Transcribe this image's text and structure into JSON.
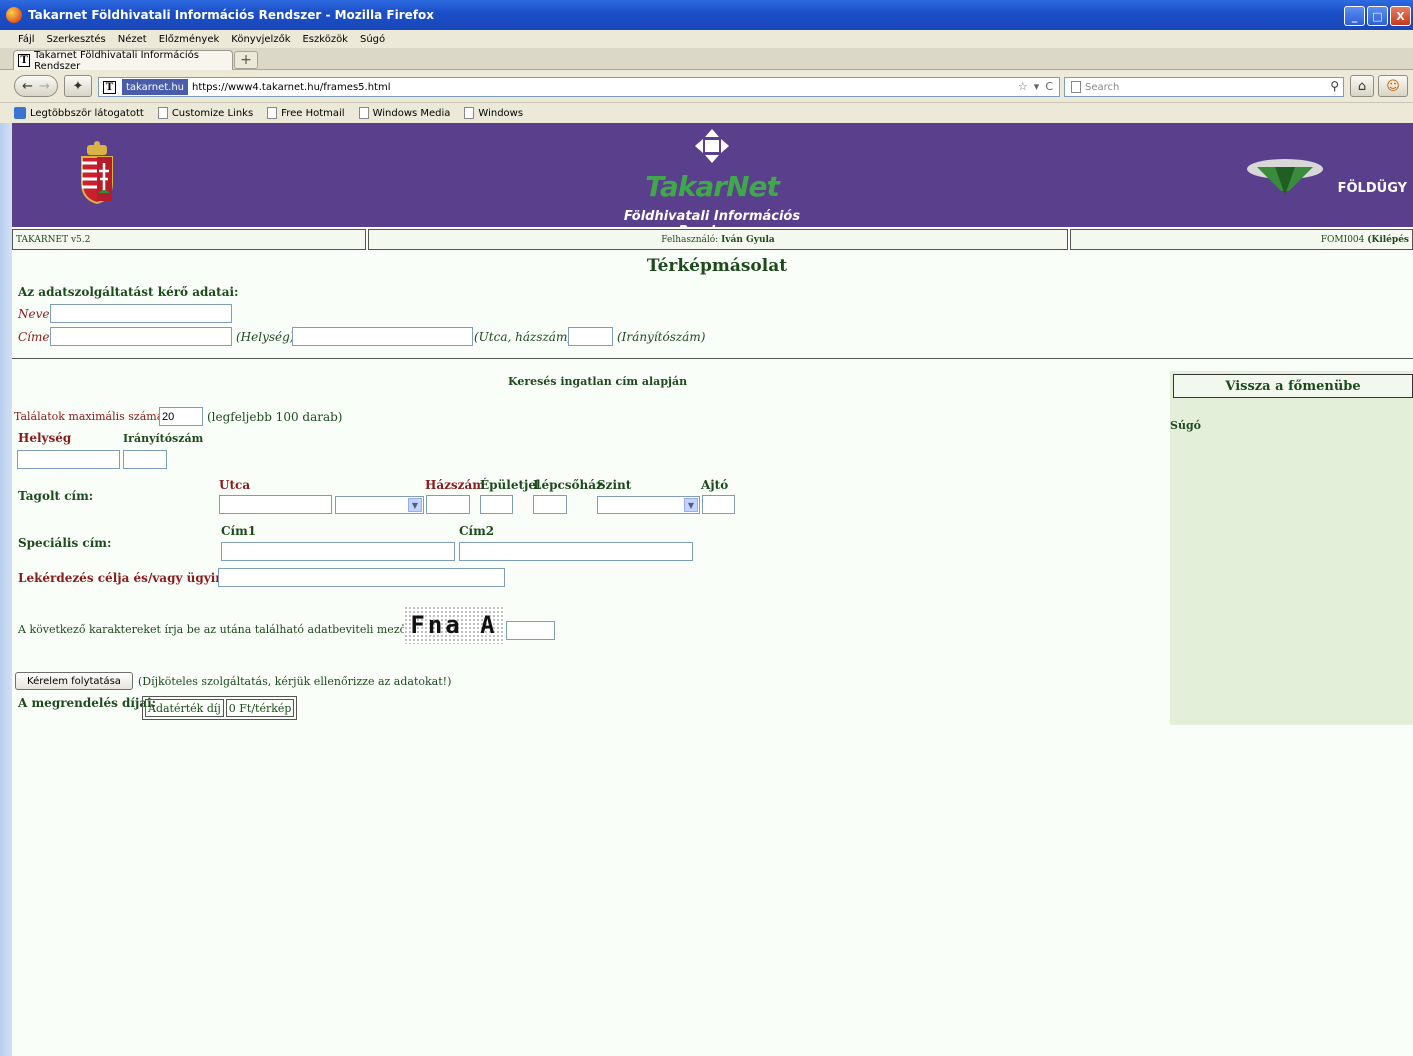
{
  "window": {
    "title": "Takarnet Földhivatali Információs Rendszer - Mozilla Firefox",
    "controls": [
      "_",
      "□",
      "X"
    ]
  },
  "menu": [
    "Fájl",
    "Szerkesztés",
    "Nézet",
    "Előzmények",
    "Könyvjelzők",
    "Eszközök",
    "Súgó"
  ],
  "tab": {
    "label": "Takarnet Földhivatali Információs Rendszer",
    "new_tab": "+"
  },
  "nav": {
    "identity": "takarnet.hu",
    "url": "https://www4.takarnet.hu/frames5.html",
    "search_placeholder": "Search"
  },
  "bookmarks": [
    "Legtöbbször látogatott",
    "Customize Links",
    "Free Hotmail",
    "Windows Media",
    "Windows"
  ],
  "header": {
    "logo_word": "TakarNet",
    "logo_subtitle": "Földhivatali Információs Rendszer",
    "right_logo": "FÖLDÜGY"
  },
  "status": {
    "version": "TAKARNET v5.2",
    "user_label": "Felhasználó:",
    "user_name": "Iván Gyula",
    "account": "FOMI004",
    "logout": "(Kilépés"
  },
  "page": {
    "title": "Térképmásolat",
    "requester_heading": "Az adatszolgáltatást kérő adatai:",
    "name_label": "Neve",
    "address_label": "Címe",
    "locality_hint": "(Helység)",
    "street_hint": "(Utca, házszám)",
    "zip_hint": "(Irányítószám)",
    "search_heading": "Keresés ingatlan cím alapján",
    "max_results_label": "Találatok maximális száma:",
    "max_results_value": "20",
    "max_results_note": "(legfeljebb 100 darab)",
    "locality_col": "Helység",
    "zip_col": "Irányítószám",
    "structured_label": "Tagolt cím:",
    "street_col": "Utca",
    "house_no_col": "Házszám",
    "building_col": "Épületjel",
    "staircase_col": "Lépcsőház",
    "floor_col": "Szint",
    "door_col": "Ajtó",
    "special_label": "Speciális cím:",
    "addr1_col": "Cím1",
    "addr2_col": "Cím2",
    "purpose_label": "Lekérdezés célja és/vagy ügyirat:",
    "captcha_prompt": "A következő karaktereket írja be az utána található adatbeviteli mezőbe:",
    "captcha_text": "Fna A",
    "submit_label": "Kérelem folytatása",
    "submit_note": "(Díjköteles szolgáltatás, kérjük ellenőrizze az adatokat!)",
    "fees_label": "A megrendelés díjai:",
    "fee_name": "Adatérték díj",
    "fee_value": "0 Ft/térkép"
  },
  "sidebar": {
    "back_label": "Vissza a főmenübe",
    "help_label": "Súgó"
  },
  "colors": {
    "header_bg": "#5a3f8c",
    "text_green": "#1d4a1d",
    "text_red": "#8b1a1a",
    "panel_bg": "#e3efd9"
  }
}
